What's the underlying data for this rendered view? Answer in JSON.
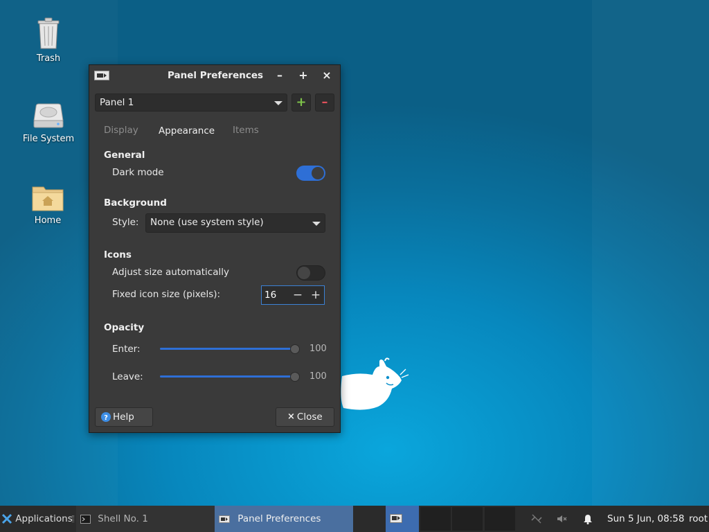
{
  "desktop": {
    "icons": [
      {
        "label": "Trash",
        "icon": "trash-icon"
      },
      {
        "label": "File System",
        "icon": "drive-icon"
      },
      {
        "label": "Home",
        "icon": "home-folder-icon"
      }
    ]
  },
  "window": {
    "title": "Panel Preferences",
    "titlebar_buttons": {
      "minimize": "–",
      "maximize": "+",
      "close": "×"
    },
    "panel_select": {
      "value": "Panel 1"
    },
    "add_button": "+",
    "remove_button": "–",
    "tabs": [
      {
        "label": "Display",
        "active": false
      },
      {
        "label": "Appearance",
        "active": true
      },
      {
        "label": "Items",
        "active": false
      }
    ],
    "general": {
      "heading": "General",
      "dark_mode_label": "Dark mode",
      "dark_mode_on": true
    },
    "background": {
      "heading": "Background",
      "style_label": "Style:",
      "style_value": "None (use system style)"
    },
    "icons": {
      "heading": "Icons",
      "adjust_label": "Adjust size automatically",
      "adjust_on": false,
      "fixed_label": "Fixed icon size (pixels):",
      "fixed_value": "16",
      "minus": "−",
      "plus": "+"
    },
    "opacity": {
      "heading": "Opacity",
      "enter_label": "Enter:",
      "enter_value": "100",
      "leave_label": "Leave:",
      "leave_value": "100"
    },
    "help_button": "Help",
    "close_button": "Close"
  },
  "taskbar": {
    "applications": "Applications",
    "tasks": [
      {
        "label": "Shell No. 1",
        "active": false
      },
      {
        "label": "Panel Preferences",
        "active": true
      }
    ],
    "clock": "Sun  5 Jun, 08:58",
    "user": "root"
  },
  "colors": {
    "accent": "#2e6fd6",
    "window_bg": "#3a3a3a",
    "taskbar_bg": "#2b2b2b",
    "remove_red": "#e0505a",
    "add_green": "#7ec34a"
  }
}
